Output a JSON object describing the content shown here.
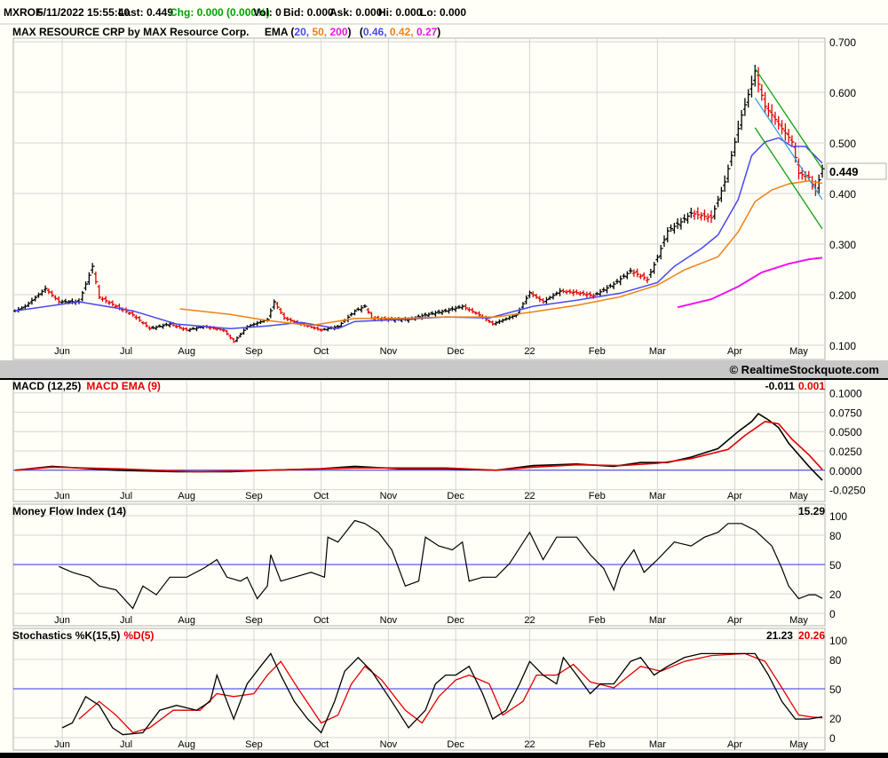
{
  "header": {
    "symbol": "MXROF",
    "datetime": "5/11/2022 15:55:40",
    "last": "Last: 0.449",
    "chg": "Chg: 0.000 (0.000%)",
    "vol": "Vol: 0",
    "bid": "Bid: 0.000",
    "ask": "Ask: 0.000",
    "hi": "Hi: 0.000",
    "lo": "Lo: 0.000"
  },
  "price_panel": {
    "title": "MAX RESOURCE CRP by MAX Resource Corp.",
    "ema_label": "EMA (",
    "ema_periods": [
      "20,",
      "50,",
      "200"
    ],
    "ema_close": ")",
    "ema_values_open": "(",
    "ema_values": [
      "0.46,",
      "0.42,",
      "0.27"
    ],
    "ema_values_close": ")",
    "last_price_box": "0.449",
    "copyright": "© RealtimeStockquote.com"
  },
  "colors": {
    "ema20": "#4848f0",
    "ema50": "#f08010",
    "ema200": "#f010f0",
    "trend": "#10a010",
    "trend_mid": "#30a0e0",
    "up": "#000000",
    "down": "#e00000",
    "signal": "#e00000",
    "ref": "#3030e0",
    "chg": "#00a000"
  },
  "months": [
    {
      "label": "Jun",
      "day": 14
    },
    {
      "label": "Jul",
      "day": 33
    },
    {
      "label": "Aug",
      "day": 51
    },
    {
      "label": "Sep",
      "day": 71
    },
    {
      "label": "Oct",
      "day": 91
    },
    {
      "label": "Nov",
      "day": 111
    },
    {
      "label": "Dec",
      "day": 131
    },
    {
      "label": "22",
      "day": 153
    },
    {
      "label": "Feb",
      "day": 173
    },
    {
      "label": "Mar",
      "day": 191
    },
    {
      "label": "Apr",
      "day": 214
    },
    {
      "label": "May",
      "day": 233
    }
  ],
  "chart_data": [
    {
      "type": "line",
      "name": "price",
      "xlabel": "trading day index",
      "ylim": [
        0.1,
        0.7
      ],
      "yticks": [
        "0.700",
        "0.600",
        "0.500",
        "0.400",
        "0.300",
        "0.200",
        "0.100"
      ],
      "close": [
        [
          0,
          0.168
        ],
        [
          3,
          0.177
        ],
        [
          9,
          0.212
        ],
        [
          13,
          0.186
        ],
        [
          19,
          0.186
        ],
        [
          23,
          0.256
        ],
        [
          25,
          0.195
        ],
        [
          30,
          0.177
        ],
        [
          35,
          0.16
        ],
        [
          40,
          0.133
        ],
        [
          46,
          0.142
        ],
        [
          51,
          0.13
        ],
        [
          56,
          0.137
        ],
        [
          62,
          0.13
        ],
        [
          65,
          0.107
        ],
        [
          69,
          0.137
        ],
        [
          75,
          0.151
        ],
        [
          77,
          0.186
        ],
        [
          80,
          0.154
        ],
        [
          85,
          0.142
        ],
        [
          91,
          0.13
        ],
        [
          96,
          0.137
        ],
        [
          101,
          0.168
        ],
        [
          104,
          0.177
        ],
        [
          106,
          0.154
        ],
        [
          112,
          0.151
        ],
        [
          117,
          0.151
        ],
        [
          122,
          0.16
        ],
        [
          128,
          0.168
        ],
        [
          133,
          0.177
        ],
        [
          138,
          0.16
        ],
        [
          142,
          0.142
        ],
        [
          149,
          0.16
        ],
        [
          153,
          0.204
        ],
        [
          157,
          0.186
        ],
        [
          162,
          0.207
        ],
        [
          167,
          0.204
        ],
        [
          172,
          0.198
        ],
        [
          178,
          0.221
        ],
        [
          183,
          0.247
        ],
        [
          188,
          0.23
        ],
        [
          191,
          0.274
        ],
        [
          194,
          0.326
        ],
        [
          198,
          0.344
        ],
        [
          201,
          0.361
        ],
        [
          207,
          0.352
        ],
        [
          211,
          0.423
        ],
        [
          213,
          0.475
        ],
        [
          216,
          0.555
        ],
        [
          219,
          0.616
        ],
        [
          220,
          0.642
        ],
        [
          221,
          0.616
        ],
        [
          223,
          0.572
        ],
        [
          225,
          0.555
        ],
        [
          228,
          0.528
        ],
        [
          231,
          0.502
        ],
        [
          233,
          0.44
        ],
        [
          236,
          0.432
        ],
        [
          238,
          0.405
        ],
        [
          240,
          0.449
        ]
      ],
      "ema20": [
        [
          0,
          0.168
        ],
        [
          19,
          0.186
        ],
        [
          35,
          0.168
        ],
        [
          48,
          0.142
        ],
        [
          64,
          0.133
        ],
        [
          75,
          0.138
        ],
        [
          85,
          0.145
        ],
        [
          96,
          0.133
        ],
        [
          101,
          0.147
        ],
        [
          115,
          0.151
        ],
        [
          128,
          0.156
        ],
        [
          141,
          0.154
        ],
        [
          154,
          0.177
        ],
        [
          167,
          0.189
        ],
        [
          180,
          0.203
        ],
        [
          191,
          0.224
        ],
        [
          196,
          0.256
        ],
        [
          204,
          0.291
        ],
        [
          209,
          0.318
        ],
        [
          215,
          0.388
        ],
        [
          219,
          0.475
        ],
        [
          223,
          0.502
        ],
        [
          227,
          0.51
        ],
        [
          231,
          0.493
        ],
        [
          235,
          0.493
        ],
        [
          240,
          0.46
        ]
      ],
      "ema50": [
        [
          49,
          0.172
        ],
        [
          64,
          0.161
        ],
        [
          75,
          0.149
        ],
        [
          88,
          0.139
        ],
        [
          101,
          0.153
        ],
        [
          114,
          0.153
        ],
        [
          128,
          0.156
        ],
        [
          143,
          0.156
        ],
        [
          154,
          0.166
        ],
        [
          167,
          0.179
        ],
        [
          180,
          0.196
        ],
        [
          191,
          0.219
        ],
        [
          199,
          0.249
        ],
        [
          209,
          0.275
        ],
        [
          215,
          0.324
        ],
        [
          220,
          0.384
        ],
        [
          225,
          0.407
        ],
        [
          230,
          0.419
        ],
        [
          236,
          0.425
        ],
        [
          240,
          0.42
        ]
      ],
      "ema200": [
        [
          197,
          0.175
        ],
        [
          207,
          0.191
        ],
        [
          215,
          0.216
        ],
        [
          222,
          0.244
        ],
        [
          230,
          0.261
        ],
        [
          236,
          0.27
        ],
        [
          240,
          0.273
        ]
      ],
      "trendlines": [
        {
          "name": "upper",
          "points": [
            [
              220,
              0.647
            ],
            [
              240,
              0.449
            ]
          ]
        },
        {
          "name": "mid",
          "points": [
            [
              220,
              0.589
            ],
            [
              240,
              0.388
            ]
          ]
        },
        {
          "name": "lower",
          "points": [
            [
              220,
              0.53
            ],
            [
              240,
              0.33
            ]
          ]
        }
      ]
    },
    {
      "type": "line",
      "name": "macd",
      "title": "MACD (12,25)",
      "signal_title": "MACD EMA (9)",
      "last_macd": "-0.011",
      "last_signal": "0.001",
      "ylim": [
        -0.025,
        0.1
      ],
      "yticks": [
        "0.1000",
        "0.0750",
        "0.0500",
        "0.0250",
        "0.0000",
        "-0.0250"
      ],
      "macd": [
        [
          0,
          0
        ],
        [
          11,
          0.005
        ],
        [
          30,
          0
        ],
        [
          48,
          -0.002
        ],
        [
          64,
          -0.002
        ],
        [
          75,
          0
        ],
        [
          91,
          0.002
        ],
        [
          101,
          0.005
        ],
        [
          114,
          0.002
        ],
        [
          128,
          0.002
        ],
        [
          143,
          0
        ],
        [
          154,
          0.006
        ],
        [
          167,
          0.008
        ],
        [
          178,
          0.005
        ],
        [
          186,
          0.01
        ],
        [
          194,
          0.01
        ],
        [
          201,
          0.017
        ],
        [
          209,
          0.028
        ],
        [
          215,
          0.05
        ],
        [
          219,
          0.063
        ],
        [
          221,
          0.073
        ],
        [
          224,
          0.065
        ],
        [
          227,
          0.055
        ],
        [
          230,
          0.035
        ],
        [
          233,
          0.02
        ],
        [
          236,
          0.005
        ],
        [
          238,
          -0.004
        ],
        [
          240,
          -0.013
        ]
      ],
      "signal": [
        [
          0,
          0
        ],
        [
          11,
          0.004
        ],
        [
          30,
          0.002
        ],
        [
          54,
          -0.002
        ],
        [
          75,
          0
        ],
        [
          101,
          0.003
        ],
        [
          128,
          0.003
        ],
        [
          143,
          0
        ],
        [
          154,
          0.004
        ],
        [
          167,
          0.007
        ],
        [
          180,
          0.006
        ],
        [
          191,
          0.009
        ],
        [
          201,
          0.015
        ],
        [
          212,
          0.027
        ],
        [
          217,
          0.045
        ],
        [
          223,
          0.063
        ],
        [
          227,
          0.06
        ],
        [
          231,
          0.04
        ],
        [
          236,
          0.02
        ],
        [
          240,
          0.001
        ]
      ]
    },
    {
      "type": "line",
      "name": "mfi",
      "title": "Money Flow Index (14)",
      "last": "15.29",
      "ylim": [
        0,
        100
      ],
      "yticks": [
        "100",
        "80",
        "50",
        "20",
        "0"
      ],
      "values": [
        [
          13,
          48
        ],
        [
          17,
          42
        ],
        [
          22,
          37
        ],
        [
          25,
          28
        ],
        [
          30,
          24
        ],
        [
          35,
          5
        ],
        [
          38,
          28
        ],
        [
          42,
          19
        ],
        [
          46,
          37
        ],
        [
          51,
          37
        ],
        [
          56,
          46
        ],
        [
          60,
          55
        ],
        [
          63,
          37
        ],
        [
          67,
          33
        ],
        [
          69,
          37
        ],
        [
          72,
          15
        ],
        [
          75,
          28
        ],
        [
          76,
          60
        ],
        [
          79,
          33
        ],
        [
          83,
          37
        ],
        [
          88,
          42
        ],
        [
          92,
          37
        ],
        [
          93,
          78
        ],
        [
          96,
          73
        ],
        [
          101,
          95
        ],
        [
          104,
          92
        ],
        [
          108,
          83
        ],
        [
          112,
          65
        ],
        [
          116,
          28
        ],
        [
          120,
          33
        ],
        [
          122,
          78
        ],
        [
          126,
          69
        ],
        [
          130,
          65
        ],
        [
          133,
          73
        ],
        [
          135,
          33
        ],
        [
          139,
          37
        ],
        [
          143,
          37
        ],
        [
          147,
          51
        ],
        [
          153,
          83
        ],
        [
          157,
          55
        ],
        [
          161,
          78
        ],
        [
          167,
          78
        ],
        [
          171,
          60
        ],
        [
          175,
          46
        ],
        [
          178,
          24
        ],
        [
          180,
          46
        ],
        [
          184,
          65
        ],
        [
          187,
          42
        ],
        [
          191,
          55
        ],
        [
          196,
          73
        ],
        [
          201,
          69
        ],
        [
          205,
          78
        ],
        [
          209,
          83
        ],
        [
          212,
          92
        ],
        [
          216,
          92
        ],
        [
          220,
          85
        ],
        [
          225,
          69
        ],
        [
          228,
          46
        ],
        [
          230,
          28
        ],
        [
          233,
          15
        ],
        [
          236,
          19
        ],
        [
          238,
          19
        ],
        [
          240,
          15.29
        ]
      ]
    },
    {
      "type": "line",
      "name": "stochastics",
      "title": "Stochastics %K(15,5)",
      "d_title": "%D(5)",
      "last_k": "21.23",
      "last_d": "20.26",
      "ylim": [
        0,
        100
      ],
      "yticks": [
        "100",
        "80",
        "50",
        "20",
        "0"
      ],
      "k": [
        [
          14,
          10
        ],
        [
          17,
          15
        ],
        [
          21,
          42
        ],
        [
          25,
          33
        ],
        [
          29,
          10
        ],
        [
          32,
          3
        ],
        [
          38,
          5
        ],
        [
          43,
          28
        ],
        [
          48,
          33
        ],
        [
          54,
          28
        ],
        [
          58,
          37
        ],
        [
          60,
          64
        ],
        [
          63,
          37
        ],
        [
          65,
          19
        ],
        [
          69,
          55
        ],
        [
          73,
          73
        ],
        [
          76,
          86
        ],
        [
          79,
          64
        ],
        [
          83,
          37
        ],
        [
          87,
          19
        ],
        [
          91,
          5
        ],
        [
          95,
          37
        ],
        [
          98,
          68
        ],
        [
          102,
          82
        ],
        [
          106,
          68
        ],
        [
          112,
          37
        ],
        [
          117,
          10
        ],
        [
          122,
          28
        ],
        [
          125,
          55
        ],
        [
          128,
          64
        ],
        [
          131,
          64
        ],
        [
          135,
          73
        ],
        [
          139,
          45
        ],
        [
          142,
          19
        ],
        [
          146,
          28
        ],
        [
          150,
          55
        ],
        [
          153,
          78
        ],
        [
          157,
          64
        ],
        [
          161,
          55
        ],
        [
          163,
          82
        ],
        [
          167,
          64
        ],
        [
          171,
          45
        ],
        [
          174,
          55
        ],
        [
          178,
          55
        ],
        [
          183,
          78
        ],
        [
          186,
          82
        ],
        [
          190,
          64
        ],
        [
          194,
          73
        ],
        [
          199,
          82
        ],
        [
          204,
          86
        ],
        [
          209,
          86
        ],
        [
          215,
          86
        ],
        [
          220,
          86
        ],
        [
          224,
          64
        ],
        [
          228,
          37
        ],
        [
          232,
          19
        ],
        [
          236,
          19
        ],
        [
          240,
          21.23
        ]
      ],
      "d": [
        [
          19,
          19
        ],
        [
          25,
          37
        ],
        [
          30,
          23
        ],
        [
          35,
          5
        ],
        [
          40,
          10
        ],
        [
          47,
          28
        ],
        [
          55,
          28
        ],
        [
          60,
          45
        ],
        [
          65,
          42
        ],
        [
          71,
          45
        ],
        [
          75,
          64
        ],
        [
          79,
          78
        ],
        [
          84,
          51
        ],
        [
          91,
          15
        ],
        [
          96,
          23
        ],
        [
          100,
          55
        ],
        [
          104,
          73
        ],
        [
          109,
          59
        ],
        [
          116,
          28
        ],
        [
          121,
          15
        ],
        [
          126,
          42
        ],
        [
          131,
          59
        ],
        [
          135,
          64
        ],
        [
          141,
          55
        ],
        [
          145,
          23
        ],
        [
          151,
          37
        ],
        [
          155,
          64
        ],
        [
          161,
          64
        ],
        [
          166,
          75
        ],
        [
          171,
          57
        ],
        [
          178,
          51
        ],
        [
          186,
          73
        ],
        [
          192,
          68
        ],
        [
          199,
          78
        ],
        [
          207,
          84
        ],
        [
          217,
          86
        ],
        [
          223,
          78
        ],
        [
          228,
          51
        ],
        [
          233,
          23
        ],
        [
          237,
          21
        ],
        [
          240,
          20.26
        ]
      ]
    }
  ]
}
